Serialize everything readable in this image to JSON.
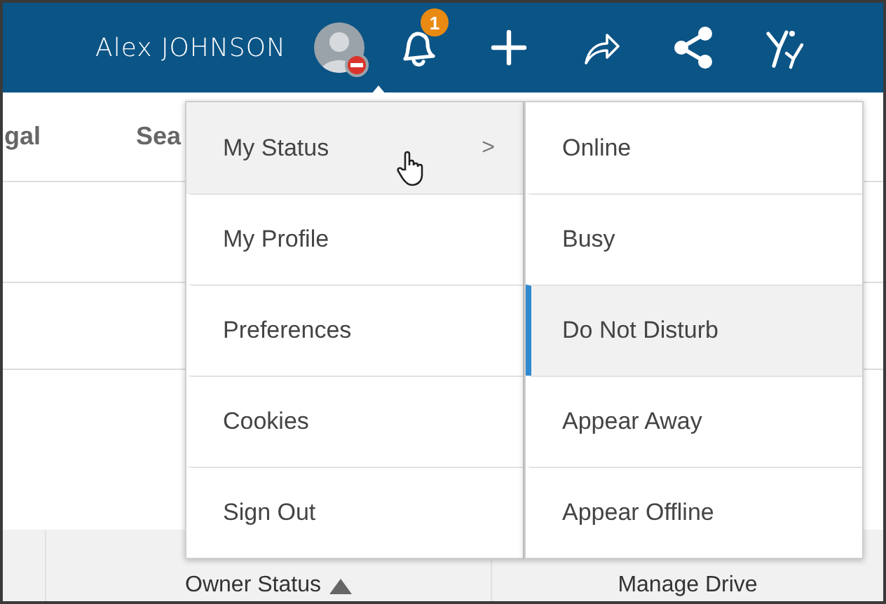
{
  "header": {
    "user_name": "Alex JOHNSON",
    "avatar_do_not_disturb": true,
    "notification_count": "1"
  },
  "tabs": [
    {
      "label": "gal",
      "selected": false
    },
    {
      "label": "Sea",
      "selected": false
    }
  ],
  "table": {
    "columns": [
      {
        "label": "Owner Status",
        "sorted_ascending": true
      },
      {
        "label": "Manage Drive",
        "sorted_ascending": false
      }
    ]
  },
  "user_menu": {
    "items": [
      {
        "label": "My Status",
        "has_submenu": true,
        "hovered": true
      },
      {
        "label": "My Profile",
        "has_submenu": false,
        "hovered": false
      },
      {
        "label": "Preferences",
        "has_submenu": false,
        "hovered": false
      },
      {
        "label": "Cookies",
        "has_submenu": false,
        "hovered": false
      },
      {
        "label": "Sign Out",
        "has_submenu": false,
        "hovered": false
      }
    ],
    "submenu_arrow": ">"
  },
  "status_menu": {
    "items": [
      {
        "label": "Online",
        "selected": false
      },
      {
        "label": "Busy",
        "selected": false
      },
      {
        "label": "Do Not Disturb",
        "selected": true
      },
      {
        "label": "Appear Away",
        "selected": false
      },
      {
        "label": "Appear Offline",
        "selected": false
      }
    ]
  }
}
